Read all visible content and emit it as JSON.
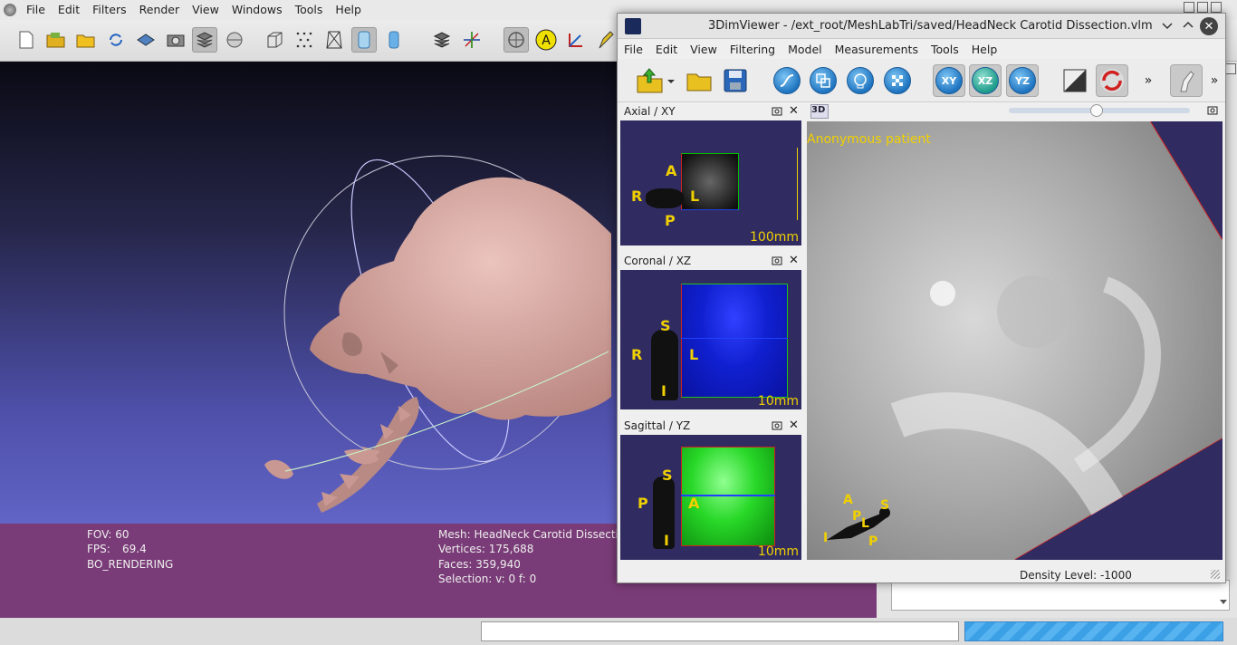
{
  "meshlab": {
    "menu": [
      "File",
      "Edit",
      "Filters",
      "Render",
      "View",
      "Windows",
      "Tools",
      "Help"
    ],
    "info": {
      "fov": "FOV: 60",
      "fps_label": "FPS:",
      "fps_value": "69.4",
      "render_mode": "BO_RENDERING",
      "mesh": "Mesh: HeadNeck Carotid Dissection.s",
      "vertices": "Vertices: 175,688",
      "faces": "Faces: 359,940",
      "selection": "Selection: v: 0 f: 0"
    },
    "colors": {
      "viewport_top": "#0a0a14",
      "viewport_bottom": "#6264c6",
      "info_bg": "#7a3c78",
      "skull": "#d9a8a2"
    }
  },
  "viewer": {
    "title": "3DimViewer - /ext_root/MeshLabTri/saved/HeadNeck Carotid Dissection.vlm",
    "menu": [
      "File",
      "Edit",
      "View",
      "Filtering",
      "Model",
      "Measurements",
      "Tools",
      "Help"
    ],
    "toolbar_overflow": "»",
    "axial": {
      "title": "Axial / XY",
      "badge": "XY",
      "scale": "100mm",
      "labels": {
        "a": "A",
        "r": "R",
        "l": "L",
        "p": "P"
      }
    },
    "coronal": {
      "title": "Coronal / XZ",
      "badge": "XZ",
      "scale": "10mm",
      "labels": {
        "s": "S",
        "r": "R",
        "l": "L",
        "i": "I"
      }
    },
    "sagittal": {
      "title": "Sagittal / YZ",
      "badge": "YZ",
      "scale": "10mm",
      "labels": {
        "s": "S",
        "p": "P",
        "a": "A",
        "i": "I"
      }
    },
    "view3d": {
      "badge": "3D",
      "patient": "Anonymous patient",
      "orient": {
        "a": "A",
        "p1": "P",
        "l": "L",
        "s": "S",
        "p2": "P",
        "i": "I"
      }
    },
    "status": "Density Level: -1000",
    "buttons": {
      "xy": "XY",
      "xz": "XZ",
      "yz": "YZ"
    },
    "colors": {
      "panel_bg": "#302c62",
      "label": "#f0d000",
      "axial_box": "#00c000",
      "coronal_fill": "#1020e0",
      "sagittal_fill": "#10d010"
    }
  }
}
